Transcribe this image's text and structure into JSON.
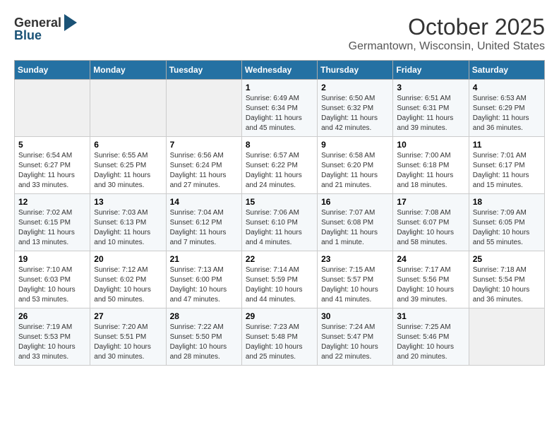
{
  "logo": {
    "general": "General",
    "blue": "Blue"
  },
  "title": "October 2025",
  "location": "Germantown, Wisconsin, United States",
  "days_of_week": [
    "Sunday",
    "Monday",
    "Tuesday",
    "Wednesday",
    "Thursday",
    "Friday",
    "Saturday"
  ],
  "weeks": [
    [
      {
        "day": "",
        "info": ""
      },
      {
        "day": "",
        "info": ""
      },
      {
        "day": "",
        "info": ""
      },
      {
        "day": "1",
        "info": "Sunrise: 6:49 AM\nSunset: 6:34 PM\nDaylight: 11 hours\nand 45 minutes."
      },
      {
        "day": "2",
        "info": "Sunrise: 6:50 AM\nSunset: 6:32 PM\nDaylight: 11 hours\nand 42 minutes."
      },
      {
        "day": "3",
        "info": "Sunrise: 6:51 AM\nSunset: 6:31 PM\nDaylight: 11 hours\nand 39 minutes."
      },
      {
        "day": "4",
        "info": "Sunrise: 6:53 AM\nSunset: 6:29 PM\nDaylight: 11 hours\nand 36 minutes."
      }
    ],
    [
      {
        "day": "5",
        "info": "Sunrise: 6:54 AM\nSunset: 6:27 PM\nDaylight: 11 hours\nand 33 minutes."
      },
      {
        "day": "6",
        "info": "Sunrise: 6:55 AM\nSunset: 6:25 PM\nDaylight: 11 hours\nand 30 minutes."
      },
      {
        "day": "7",
        "info": "Sunrise: 6:56 AM\nSunset: 6:24 PM\nDaylight: 11 hours\nand 27 minutes."
      },
      {
        "day": "8",
        "info": "Sunrise: 6:57 AM\nSunset: 6:22 PM\nDaylight: 11 hours\nand 24 minutes."
      },
      {
        "day": "9",
        "info": "Sunrise: 6:58 AM\nSunset: 6:20 PM\nDaylight: 11 hours\nand 21 minutes."
      },
      {
        "day": "10",
        "info": "Sunrise: 7:00 AM\nSunset: 6:18 PM\nDaylight: 11 hours\nand 18 minutes."
      },
      {
        "day": "11",
        "info": "Sunrise: 7:01 AM\nSunset: 6:17 PM\nDaylight: 11 hours\nand 15 minutes."
      }
    ],
    [
      {
        "day": "12",
        "info": "Sunrise: 7:02 AM\nSunset: 6:15 PM\nDaylight: 11 hours\nand 13 minutes."
      },
      {
        "day": "13",
        "info": "Sunrise: 7:03 AM\nSunset: 6:13 PM\nDaylight: 11 hours\nand 10 minutes."
      },
      {
        "day": "14",
        "info": "Sunrise: 7:04 AM\nSunset: 6:12 PM\nDaylight: 11 hours\nand 7 minutes."
      },
      {
        "day": "15",
        "info": "Sunrise: 7:06 AM\nSunset: 6:10 PM\nDaylight: 11 hours\nand 4 minutes."
      },
      {
        "day": "16",
        "info": "Sunrise: 7:07 AM\nSunset: 6:08 PM\nDaylight: 11 hours\nand 1 minute."
      },
      {
        "day": "17",
        "info": "Sunrise: 7:08 AM\nSunset: 6:07 PM\nDaylight: 10 hours\nand 58 minutes."
      },
      {
        "day": "18",
        "info": "Sunrise: 7:09 AM\nSunset: 6:05 PM\nDaylight: 10 hours\nand 55 minutes."
      }
    ],
    [
      {
        "day": "19",
        "info": "Sunrise: 7:10 AM\nSunset: 6:03 PM\nDaylight: 10 hours\nand 53 minutes."
      },
      {
        "day": "20",
        "info": "Sunrise: 7:12 AM\nSunset: 6:02 PM\nDaylight: 10 hours\nand 50 minutes."
      },
      {
        "day": "21",
        "info": "Sunrise: 7:13 AM\nSunset: 6:00 PM\nDaylight: 10 hours\nand 47 minutes."
      },
      {
        "day": "22",
        "info": "Sunrise: 7:14 AM\nSunset: 5:59 PM\nDaylight: 10 hours\nand 44 minutes."
      },
      {
        "day": "23",
        "info": "Sunrise: 7:15 AM\nSunset: 5:57 PM\nDaylight: 10 hours\nand 41 minutes."
      },
      {
        "day": "24",
        "info": "Sunrise: 7:17 AM\nSunset: 5:56 PM\nDaylight: 10 hours\nand 39 minutes."
      },
      {
        "day": "25",
        "info": "Sunrise: 7:18 AM\nSunset: 5:54 PM\nDaylight: 10 hours\nand 36 minutes."
      }
    ],
    [
      {
        "day": "26",
        "info": "Sunrise: 7:19 AM\nSunset: 5:53 PM\nDaylight: 10 hours\nand 33 minutes."
      },
      {
        "day": "27",
        "info": "Sunrise: 7:20 AM\nSunset: 5:51 PM\nDaylight: 10 hours\nand 30 minutes."
      },
      {
        "day": "28",
        "info": "Sunrise: 7:22 AM\nSunset: 5:50 PM\nDaylight: 10 hours\nand 28 minutes."
      },
      {
        "day": "29",
        "info": "Sunrise: 7:23 AM\nSunset: 5:48 PM\nDaylight: 10 hours\nand 25 minutes."
      },
      {
        "day": "30",
        "info": "Sunrise: 7:24 AM\nSunset: 5:47 PM\nDaylight: 10 hours\nand 22 minutes."
      },
      {
        "day": "31",
        "info": "Sunrise: 7:25 AM\nSunset: 5:46 PM\nDaylight: 10 hours\nand 20 minutes."
      },
      {
        "day": "",
        "info": ""
      }
    ]
  ]
}
